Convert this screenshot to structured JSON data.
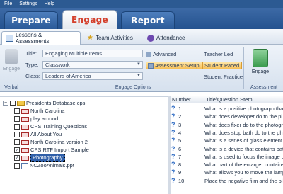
{
  "menu": [
    "File",
    "Settings",
    "Help"
  ],
  "modes": {
    "prepare": "Prepare",
    "engage": "Engage",
    "report": "Report"
  },
  "tabs": {
    "lessons": "Lessons & Assessments",
    "team": "Team Activities",
    "attendance": "Attendance"
  },
  "verbal": {
    "engage_label": "Engage",
    "group_label": "Verbal"
  },
  "fields": {
    "title_label": "Title:",
    "title_value": "Engaging Multiple Items",
    "type_label": "Type:",
    "type_value": "Classwork",
    "class_label": "Class:",
    "class_value": "Leaders of America"
  },
  "options": {
    "advanced": "Advanced",
    "assessment_setup": "Assessment Setup",
    "teacher_led": "Teacher Led",
    "student_paced": "Student Paced",
    "student_practice": "Student Practice",
    "group_label": "Engage Options"
  },
  "assessment": {
    "engage_label": "Engage",
    "group_label": "Assessment"
  },
  "tree": {
    "root": "Presidents Database.cps",
    "items": [
      {
        "label": "North Carolina",
        "checked": false,
        "icon": "book-icon"
      },
      {
        "label": "play around",
        "checked": false,
        "icon": "book-icon"
      },
      {
        "label": "CPS Training Questions",
        "checked": false,
        "icon": "book-icon"
      },
      {
        "label": "All About You",
        "checked": false,
        "icon": "book-icon"
      },
      {
        "label": "North Carolina version 2",
        "checked": false,
        "icon": "book-icon"
      },
      {
        "label": "CPS RTF Import Sample",
        "checked": true,
        "icon": "book-icon"
      },
      {
        "label": "Photography",
        "checked": true,
        "icon": "book-icon",
        "selected": true
      },
      {
        "label": "NCZooAnimals.ppt",
        "checked": false,
        "icon": "ppt-icon"
      }
    ]
  },
  "questions": {
    "col_number": "Number",
    "col_title": "Title/Question Stem",
    "rows": [
      {
        "n": "1",
        "t": "What is a positive photograph tha"
      },
      {
        "n": "2",
        "t": "What does developer do to the pl"
      },
      {
        "n": "3",
        "t": "What does fixer do to the photogr"
      },
      {
        "n": "4",
        "t": "What does stop bath do to the phi"
      },
      {
        "n": "5",
        "t": "What is a series of glass element"
      },
      {
        "n": "6",
        "t": "What is a device that contains bat"
      },
      {
        "n": "7",
        "t": "What is used to focus the image o"
      },
      {
        "n": "8",
        "t": "What part of the enlarger contains"
      },
      {
        "n": "9",
        "t": "What allows you to move the lamp"
      },
      {
        "n": "10",
        "t": "Place the negative film and the pl"
      }
    ]
  }
}
